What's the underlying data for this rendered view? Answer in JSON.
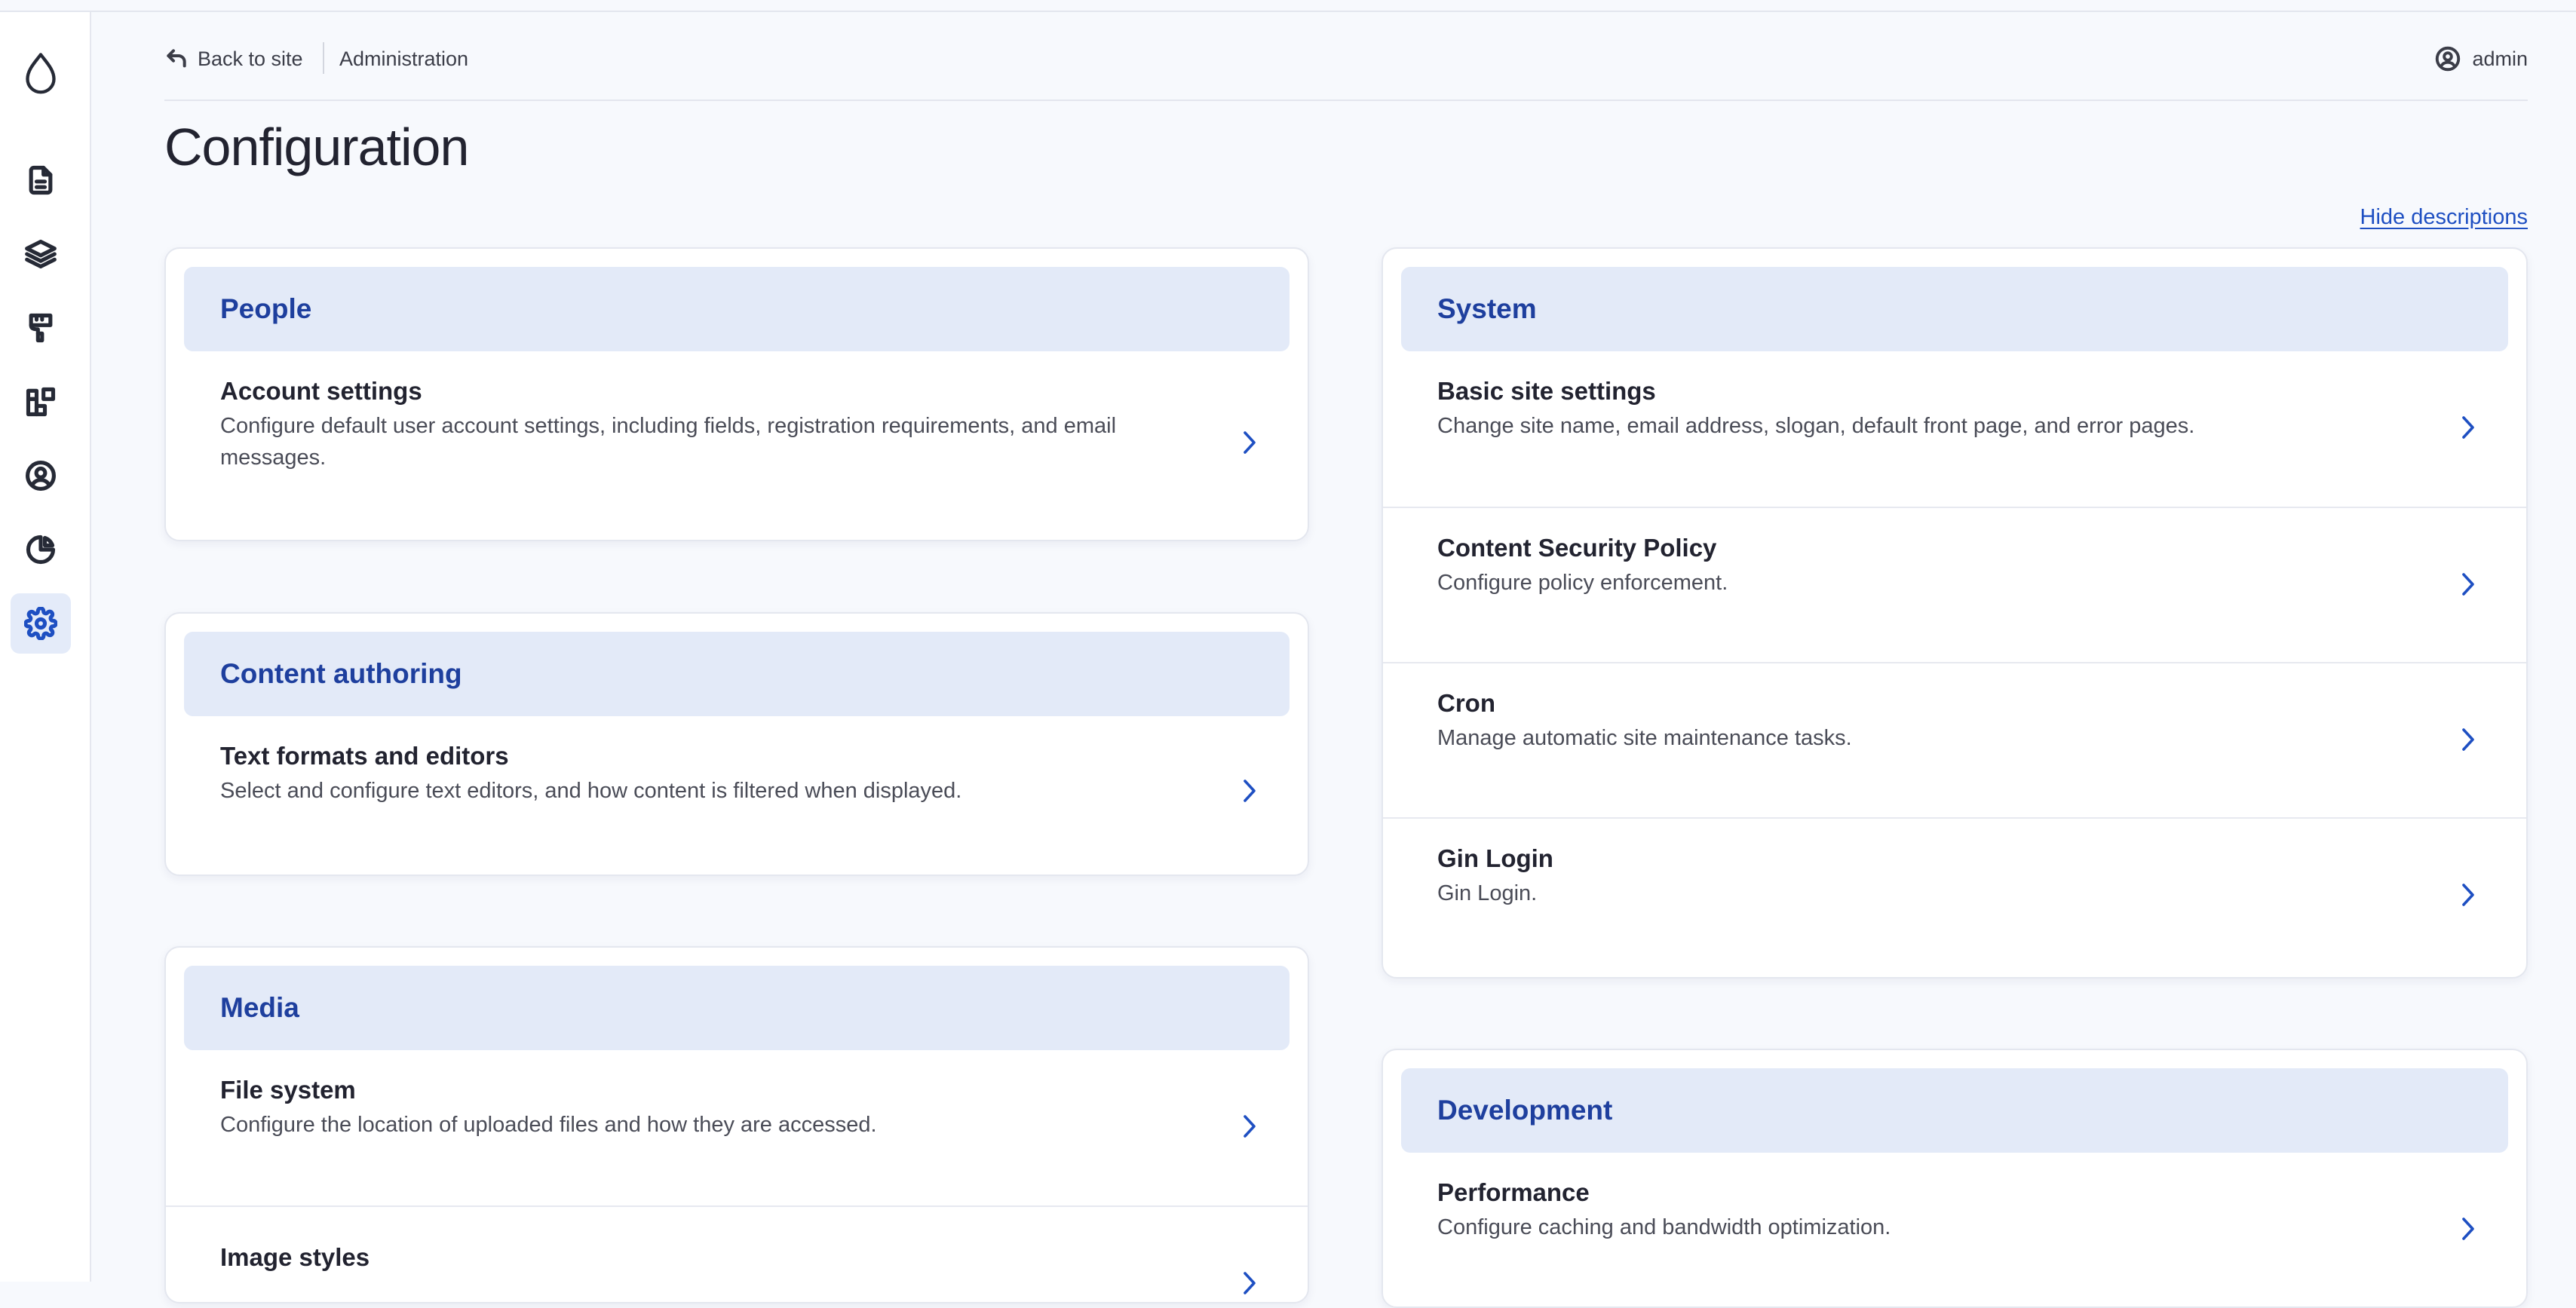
{
  "topbar": {
    "back_label": "Back to site",
    "breadcrumb": "Administration",
    "user_name": "admin"
  },
  "page": {
    "title": "Configuration",
    "hide_descriptions": "Hide descriptions"
  },
  "sidebar": {
    "items": [
      {
        "icon": "drupal-logo-icon"
      },
      {
        "icon": "content-icon"
      },
      {
        "icon": "structure-icon"
      },
      {
        "icon": "appearance-icon"
      },
      {
        "icon": "extend-icon"
      },
      {
        "icon": "people-icon"
      },
      {
        "icon": "reports-icon"
      },
      {
        "icon": "configuration-icon",
        "active": true
      }
    ]
  },
  "sections": {
    "people": {
      "title": "People",
      "items": [
        {
          "title": "Account settings",
          "desc": "Configure default user account settings, including fields, registration requirements, and email messages."
        }
      ]
    },
    "content_authoring": {
      "title": "Content authoring",
      "items": [
        {
          "title": "Text formats and editors",
          "desc": "Select and configure text editors, and how content is filtered when displayed."
        }
      ]
    },
    "media": {
      "title": "Media",
      "items": [
        {
          "title": "File system",
          "desc": "Configure the location of uploaded files and how they are accessed."
        },
        {
          "title": "Image styles",
          "desc": ""
        }
      ]
    },
    "system": {
      "title": "System",
      "items": [
        {
          "title": "Basic site settings",
          "desc": "Change site name, email address, slogan, default front page, and error pages."
        },
        {
          "title": "Content Security Policy",
          "desc": "Configure policy enforcement."
        },
        {
          "title": "Cron",
          "desc": "Manage automatic site maintenance tasks."
        },
        {
          "title": "Gin Login",
          "desc": "Gin Login."
        }
      ]
    },
    "development": {
      "title": "Development",
      "items": [
        {
          "title": "Performance",
          "desc": "Configure caching and bandwidth optimization."
        }
      ]
    }
  },
  "colors": {
    "accent": "#1e4fc2",
    "section_header_bg": "#e3eaf8",
    "page_bg": "#f7f9fd"
  }
}
